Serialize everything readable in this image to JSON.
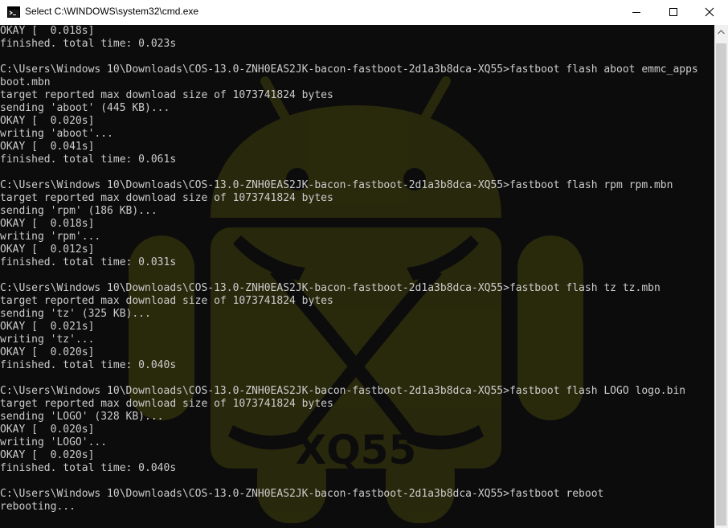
{
  "window": {
    "title": "Select C:\\WINDOWS\\system32\\cmd.exe",
    "icon": "cmd-icon"
  },
  "controls": {
    "minimize_icon": "minimize-icon",
    "maximize_icon": "maximize-icon",
    "close_icon": "close-icon"
  },
  "watermark": {
    "text": "XQ55",
    "color": "#3a3a12"
  },
  "colors": {
    "console_bg": "#0c0c0c",
    "console_text": "#cccccc"
  },
  "console": {
    "lines": [
      "OKAY [  0.018s]",
      "finished. total time: 0.023s",
      "",
      "C:\\Users\\Windows 10\\Downloads\\COS-13.0-ZNH0EAS2JK-bacon-fastboot-2d1a3b8dca-XQ55>fastboot flash aboot emmc_apps",
      "boot.mbn",
      "target reported max download size of 1073741824 bytes",
      "sending 'aboot' (445 KB)...",
      "OKAY [  0.020s]",
      "writing 'aboot'...",
      "OKAY [  0.041s]",
      "finished. total time: 0.061s",
      "",
      "C:\\Users\\Windows 10\\Downloads\\COS-13.0-ZNH0EAS2JK-bacon-fastboot-2d1a3b8dca-XQ55>fastboot flash rpm rpm.mbn",
      "target reported max download size of 1073741824 bytes",
      "sending 'rpm' (186 KB)...",
      "OKAY [  0.018s]",
      "writing 'rpm'...",
      "OKAY [  0.012s]",
      "finished. total time: 0.031s",
      "",
      "C:\\Users\\Windows 10\\Downloads\\COS-13.0-ZNH0EAS2JK-bacon-fastboot-2d1a3b8dca-XQ55>fastboot flash tz tz.mbn",
      "target reported max download size of 1073741824 bytes",
      "sending 'tz' (325 KB)...",
      "OKAY [  0.021s]",
      "writing 'tz'...",
      "OKAY [  0.020s]",
      "finished. total time: 0.040s",
      "",
      "C:\\Users\\Windows 10\\Downloads\\COS-13.0-ZNH0EAS2JK-bacon-fastboot-2d1a3b8dca-XQ55>fastboot flash LOGO logo.bin",
      "target reported max download size of 1073741824 bytes",
      "sending 'LOGO' (328 KB)...",
      "OKAY [  0.020s]",
      "writing 'LOGO'...",
      "OKAY [  0.020s]",
      "finished. total time: 0.040s",
      "",
      "C:\\Users\\Windows 10\\Downloads\\COS-13.0-ZNH0EAS2JK-bacon-fastboot-2d1a3b8dca-XQ55>fastboot reboot",
      "rebooting..."
    ]
  }
}
